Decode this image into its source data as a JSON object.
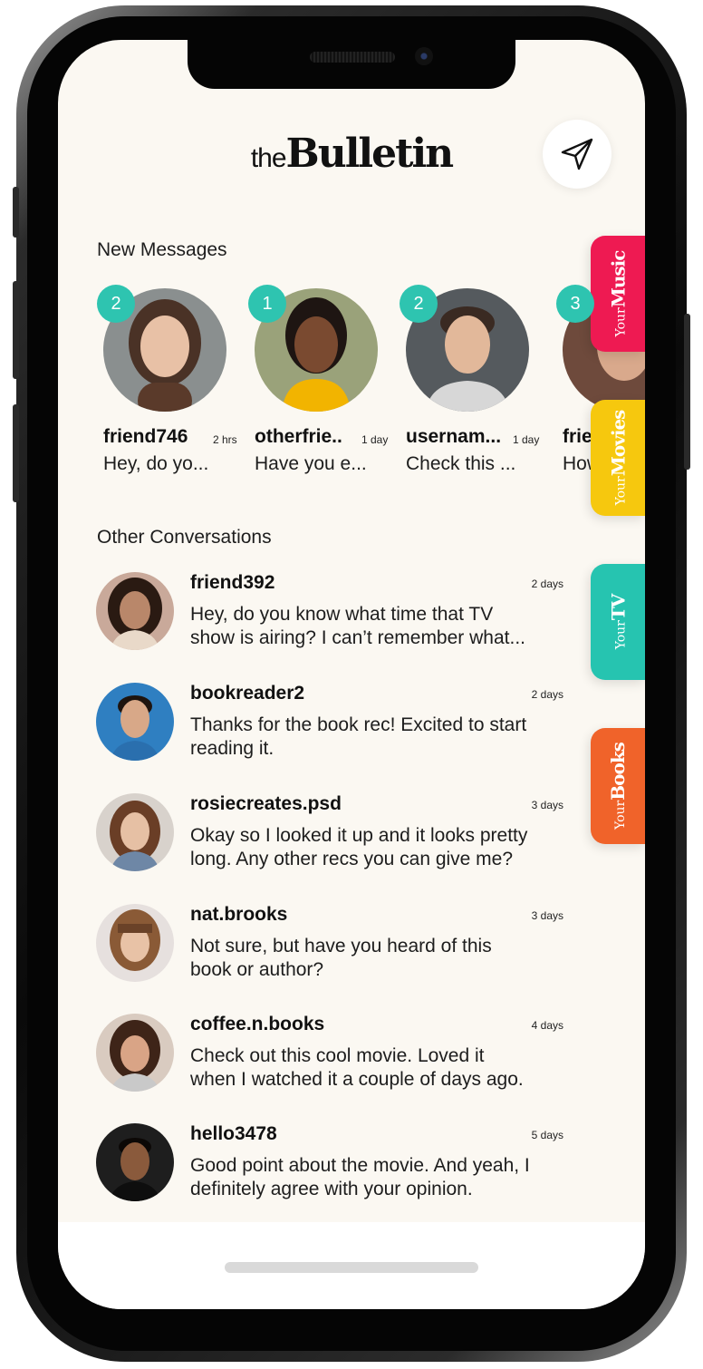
{
  "app": {
    "logo_prefix": "the",
    "logo_main": "Bulletin"
  },
  "sections": {
    "new_messages": "New Messages",
    "other_conversations": "Other Conversations"
  },
  "new_messages": [
    {
      "count": "2",
      "name": "friend746",
      "time": "2 hrs",
      "preview": "Hey, do yo...",
      "color": "#8a8f8f"
    },
    {
      "count": "1",
      "name": "otherfrie..",
      "time": "1 day",
      "preview": "Have you e...",
      "color": "#9aa27a"
    },
    {
      "count": "2",
      "name": "usernam...",
      "time": "1 day",
      "preview": "Check this ...",
      "color": "#555a5e"
    },
    {
      "count": "3",
      "name": "frie",
      "time": "",
      "preview": "How",
      "color": "#6e4a3c"
    }
  ],
  "conversations": [
    {
      "name": "friend392",
      "time": "2 days",
      "line1": "Hey, do you know what time that TV",
      "line2": "show is airing? I can’t remember what...",
      "color": "#c9a99a"
    },
    {
      "name": "bookreader2",
      "time": "2 days",
      "line1": "Thanks for the book rec! Excited to start",
      "line2": "reading it.",
      "color": "#2f7fc1"
    },
    {
      "name": "rosiecreates.psd",
      "time": "3 days",
      "line1": "Okay so I looked it up and it looks pretty",
      "line2": "long. Any other recs you can give me?",
      "color": "#d8d2cc"
    },
    {
      "name": "nat.brooks",
      "time": "3 days",
      "line1": "Not sure, but have you heard of this",
      "line2": "book or author?",
      "color": "#e6e0de"
    },
    {
      "name": "coffee.n.books",
      "time": "4 days",
      "line1": "Check out this cool movie. Loved it",
      "line2": "when I watched it a couple of days ago.",
      "color": "#d9cbc0"
    },
    {
      "name": "hello3478",
      "time": "5 days",
      "line1": "Good point about the movie. And yeah, I",
      "line2": "definitely agree with your opinion.",
      "color": "#1e1e1e"
    }
  ],
  "tabs": [
    {
      "prefix": "Your",
      "label": "Music",
      "color": "#ee1a52"
    },
    {
      "prefix": "Your",
      "label": "Movies",
      "color": "#f6c80e"
    },
    {
      "prefix": "Your",
      "label": "TV",
      "color": "#26c4b0"
    },
    {
      "prefix": "Your",
      "label": "Books",
      "color": "#f0632a"
    }
  ],
  "icons": {
    "send": "send-icon"
  }
}
